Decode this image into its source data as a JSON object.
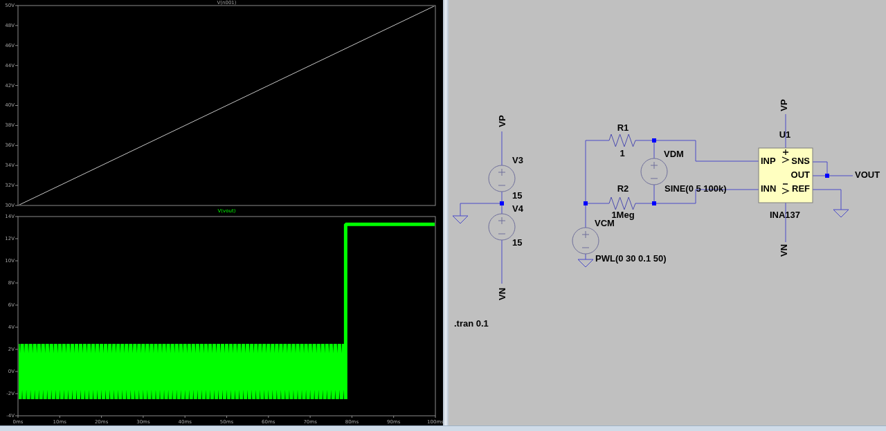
{
  "waveform_viewer": {
    "plots": [
      {
        "chart_data": {
          "type": "line",
          "x": [
            0,
            100
          ],
          "xlim": [
            0,
            100
          ],
          "ylim": [
            30,
            50
          ],
          "yticks": [
            {
              "value": 30,
              "label": "30V"
            },
            {
              "value": 32,
              "label": "32V"
            },
            {
              "value": 34,
              "label": "34V"
            },
            {
              "value": 36,
              "label": "36V"
            },
            {
              "value": 38,
              "label": "38V"
            },
            {
              "value": 40,
              "label": "40V"
            },
            {
              "value": 42,
              "label": "42V"
            },
            {
              "value": 44,
              "label": "44V"
            },
            {
              "value": 46,
              "label": "46V"
            },
            {
              "value": 48,
              "label": "48V"
            },
            {
              "value": 50,
              "label": "50V"
            }
          ],
          "series": [
            {
              "name": "V(n001)",
              "color": "#c8c8c8",
              "values": [
                30,
                50
              ]
            }
          ]
        }
      },
      {
        "chart_data": {
          "type": "line",
          "x": [
            0,
            0.5,
            1,
            1.5,
            2,
            2.5,
            3,
            3.5,
            4,
            4.5,
            5,
            5.5,
            6,
            6.5,
            7,
            7.5,
            8,
            8.5,
            9,
            9.5,
            10,
            10.5,
            11,
            11.5,
            12,
            12.5,
            13,
            13.5,
            14,
            14.5,
            15,
            15.5,
            16,
            16.5,
            17,
            17.5,
            18,
            18.5,
            19,
            19.5,
            20,
            20.5,
            21,
            21.5,
            22,
            22.5,
            23,
            23.5,
            24,
            24.5,
            25,
            25.5,
            26,
            26.5,
            27,
            27.5,
            28,
            28.5,
            29,
            29.5,
            30,
            30.5,
            31,
            31.5,
            32,
            32.5,
            33,
            33.5,
            34,
            34.5,
            35,
            35.5,
            36,
            36.5,
            37,
            37.5,
            38,
            38.5,
            39,
            39.5,
            40,
            40.5,
            41,
            41.5,
            42,
            42.5,
            43,
            43.5,
            44,
            44.5,
            45,
            45.5,
            46,
            46.5,
            47,
            47.5,
            48,
            48.5,
            49,
            49.5,
            50,
            50.5,
            51,
            51.5,
            52,
            52.5,
            53,
            53.5,
            54,
            54.5,
            55,
            55.5,
            56,
            56.5,
            57,
            57.5,
            58,
            58.5,
            59,
            59.5,
            60,
            60.5,
            61,
            61.5,
            62,
            62.5,
            63,
            63.5,
            64,
            64.5,
            65,
            65.5,
            66,
            66.5,
            67,
            67.5,
            68,
            68.5,
            69,
            69.5,
            70,
            70.5,
            71,
            71.5,
            72,
            72.5,
            73,
            73.5,
            74,
            74.5,
            75,
            75.5,
            76,
            76.5,
            77,
            77.5,
            78,
            78.5,
            78.5,
            100
          ],
          "xlim": [
            0,
            100
          ],
          "ylim": [
            -4,
            14
          ],
          "xticks": [
            {
              "value": 0,
              "label": "0ms"
            },
            {
              "value": 10,
              "label": "10ms"
            },
            {
              "value": 20,
              "label": "20ms"
            },
            {
              "value": 30,
              "label": "30ms"
            },
            {
              "value": 40,
              "label": "40ms"
            },
            {
              "value": 50,
              "label": "50ms"
            },
            {
              "value": 60,
              "label": "60ms"
            },
            {
              "value": 70,
              "label": "70ms"
            },
            {
              "value": 80,
              "label": "80ms"
            },
            {
              "value": 90,
              "label": "90ms"
            },
            {
              "value": 100,
              "label": "100ms"
            }
          ],
          "yticks": [
            {
              "value": -4,
              "label": "-4V"
            },
            {
              "value": -2,
              "label": "-2V"
            },
            {
              "value": 0,
              "label": "0V"
            },
            {
              "value": 2,
              "label": "2V"
            },
            {
              "value": 4,
              "label": "4V"
            },
            {
              "value": 6,
              "label": "6V"
            },
            {
              "value": 8,
              "label": "8V"
            },
            {
              "value": 10,
              "label": "10V"
            },
            {
              "value": 12,
              "label": "12V"
            },
            {
              "value": 14,
              "label": "14V"
            }
          ],
          "series": [
            {
              "name": "V(vout)",
              "color": "#00ff00",
              "values": [
                2.5,
                -2.5,
                2.5,
                -2.5,
                2.5,
                -2.5,
                2.5,
                -2.5,
                2.5,
                -2.5,
                2.5,
                -2.5,
                2.5,
                -2.5,
                2.5,
                -2.5,
                2.5,
                -2.5,
                2.5,
                -2.5,
                2.5,
                -2.5,
                2.5,
                -2.5,
                2.5,
                -2.5,
                2.5,
                -2.5,
                2.5,
                -2.5,
                2.5,
                -2.5,
                2.5,
                -2.5,
                2.5,
                -2.5,
                2.5,
                -2.5,
                2.5,
                -2.5,
                2.5,
                -2.5,
                2.5,
                -2.5,
                2.5,
                -2.5,
                2.5,
                -2.5,
                2.5,
                -2.5,
                2.5,
                -2.5,
                2.5,
                -2.5,
                2.5,
                -2.5,
                2.5,
                -2.5,
                2.5,
                -2.5,
                2.5,
                -2.5,
                2.5,
                -2.5,
                2.5,
                -2.5,
                2.5,
                -2.5,
                2.5,
                -2.5,
                2.5,
                -2.5,
                2.5,
                -2.5,
                2.5,
                -2.5,
                2.5,
                -2.5,
                2.5,
                -2.5,
                2.5,
                -2.5,
                2.5,
                -2.5,
                2.5,
                -2.5,
                2.5,
                -2.5,
                2.5,
                -2.5,
                2.5,
                -2.5,
                2.5,
                -2.5,
                2.5,
                -2.5,
                2.5,
                -2.5,
                2.5,
                -2.5,
                2.5,
                -2.5,
                2.5,
                -2.5,
                2.5,
                -2.5,
                2.5,
                -2.5,
                2.5,
                -2.5,
                2.5,
                -2.5,
                2.5,
                -2.5,
                2.5,
                -2.5,
                2.5,
                -2.5,
                2.5,
                -2.5,
                2.5,
                -2.5,
                2.5,
                -2.5,
                2.5,
                -2.5,
                2.5,
                -2.5,
                2.5,
                -2.5,
                2.5,
                -2.5,
                2.5,
                -2.5,
                2.5,
                -2.5,
                2.5,
                -2.5,
                2.5,
                -2.5,
                2.5,
                -2.5,
                2.5,
                -2.5,
                2.5,
                -2.5,
                2.5,
                -2.5,
                2.5,
                -2.5,
                2.5,
                -2.5,
                2.5,
                -2.5,
                2.5,
                -2.5,
                2.5,
                -2.5,
                13.3,
                13.3
              ]
            }
          ]
        }
      }
    ]
  },
  "schematic": {
    "components": [
      {
        "kind": "source",
        "ref": "V3",
        "value": "15"
      },
      {
        "kind": "source",
        "ref": "V4",
        "value": "15"
      },
      {
        "kind": "resistor",
        "ref": "R1",
        "value": "1"
      },
      {
        "kind": "resistor",
        "ref": "R2",
        "value": "1Meg"
      },
      {
        "kind": "source",
        "ref": "VDM",
        "value": "SINE(0 5 100k)"
      },
      {
        "kind": "source",
        "ref": "VCM",
        "value": "PWL(0 30 0.1 50)"
      },
      {
        "kind": "amplifier",
        "ref": "U1",
        "value": "INA137",
        "pins": [
          "INP",
          "SNS",
          "OUT",
          "INN",
          "REF"
        ]
      }
    ],
    "net_labels": [
      "VP",
      "VN",
      "VP",
      "VN",
      "VOUT"
    ],
    "directive": ".tran 0.1"
  }
}
